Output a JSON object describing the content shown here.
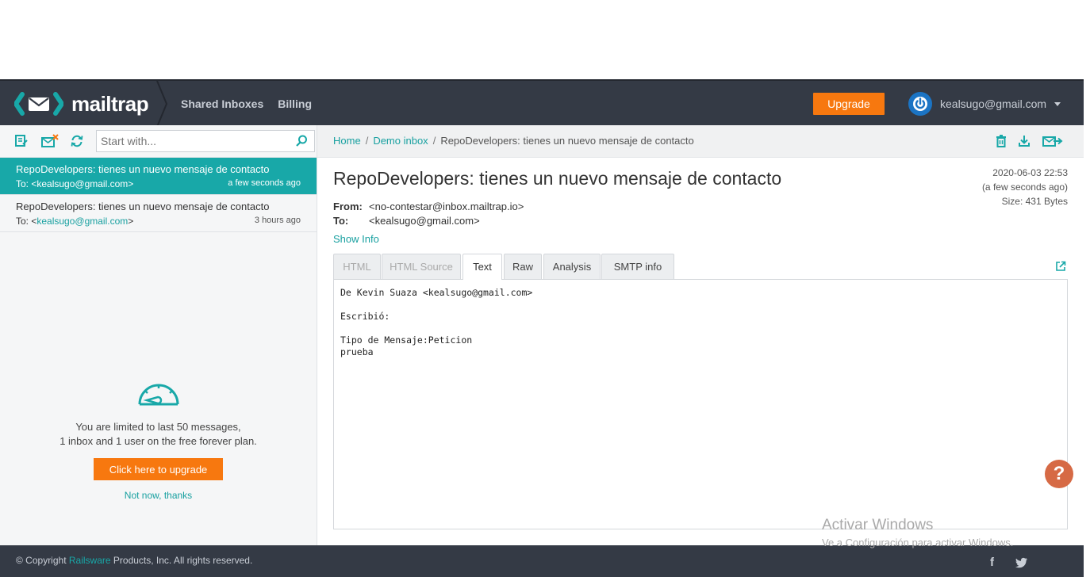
{
  "header": {
    "brand": "mailtrap",
    "nav": [
      "Shared Inboxes",
      "Billing"
    ],
    "upgrade_label": "Upgrade",
    "user_email": "kealsugo@gmail.com"
  },
  "sidebar": {
    "search_placeholder": "Start with...",
    "messages": [
      {
        "subject": "RepoDevelopers: tienes un nuevo mensaje de contacto",
        "to_prefix": "To: <",
        "to_addr": "kealsugo@gmail.com",
        "to_suffix": ">",
        "time": "a few seconds ago",
        "active": true
      },
      {
        "subject": "RepoDevelopers: tienes un nuevo mensaje de contacto",
        "to_prefix": "To: <",
        "to_addr": "kealsugo@gmail.com",
        "to_suffix": ">",
        "time": "3 hours ago",
        "active": false
      }
    ],
    "limit": {
      "line1": "You are limited to last 50 messages,",
      "line2": "1 inbox and 1 user on the free forever plan.",
      "button": "Click here to upgrade",
      "dismiss": "Not now, thanks"
    }
  },
  "breadcrumb": {
    "home": "Home",
    "inbox": "Demo inbox",
    "current": "RepoDevelopers: tienes un nuevo mensaje de contacto"
  },
  "message": {
    "subject": "RepoDevelopers: tienes un nuevo mensaje de contacto",
    "date": "2020-06-03 22:53",
    "relative": "(a few seconds ago)",
    "size": "Size: 431 Bytes",
    "from_label": "From:",
    "from": "<no-contestar@inbox.mailtrap.io>",
    "to_label": "To:",
    "to": "<kealsugo@gmail.com>",
    "show_info": "Show Info",
    "tabs": [
      "HTML",
      "HTML Source",
      "Text",
      "Raw",
      "Analysis",
      "SMTP info"
    ],
    "active_tab": "Text",
    "body": "De Kevin Suaza <kealsugo@gmail.com>\n\nEscribió:\n\nTipo de Mensaje:Peticion\nprueba"
  },
  "footer": {
    "copy_prefix": "© Copyright ",
    "company": "Railsware",
    "copy_suffix": " Products, Inc. All rights reserved.",
    "facebook": "f"
  },
  "watermark": {
    "title": "Activar Windows",
    "subtitle": "Ve a Configuración para activar Windows."
  },
  "help_label": "?",
  "colors": {
    "accent": "#18a8a8",
    "orange": "#f7780f",
    "dark": "#343a45"
  }
}
